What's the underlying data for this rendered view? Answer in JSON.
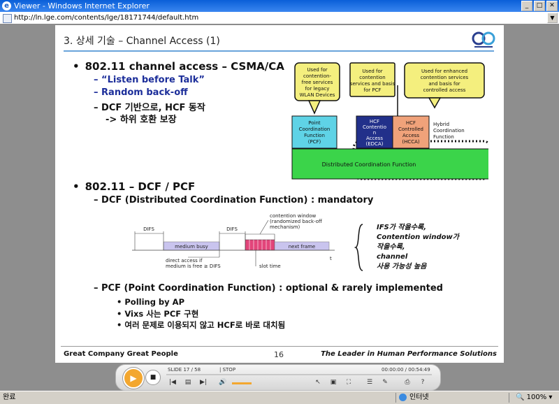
{
  "window": {
    "title": "Viewer - Windows Internet Explorer",
    "address": "http://ln.lge.com/contents/lge/18171744/default.htm"
  },
  "slide": {
    "title": "3. 상세 기술 – Channel Access (1)",
    "bullet1": "802.11 channel access – CSMA/CA",
    "sub1_1": "“Listen before Talk”",
    "sub1_2": "Random back-off",
    "sub1_3": "DCF 기반으로, HCF 동작",
    "sub1_4": "-> 하위 호환 보장",
    "diagram1": {
      "callout1": [
        "Used for",
        "contention-",
        "free services",
        "for legacy",
        "WLAN Devices"
      ],
      "callout2": [
        "Used for",
        "contention",
        "services and basis",
        "for PCF"
      ],
      "callout3": [
        "Used for enhanced",
        "contention services",
        "and basis for",
        "controlled access"
      ],
      "pcf": [
        "Point",
        "Coordination",
        "Function",
        "(PCF)"
      ],
      "hcf_contention": [
        "HCF",
        "Contentio",
        "n",
        "Access",
        "(EDCA)"
      ],
      "hcf_controlled": [
        "HCF",
        "Controlled",
        "Access",
        "(HCCA)"
      ],
      "hybrid": [
        "Hybrid",
        "Coordination",
        "Function"
      ],
      "dcf": "Distributed Coordination Function"
    },
    "bullet2": "802.11 – DCF / PCF",
    "sub2_1": "DCF (Distributed Coordination Function) : mandatory",
    "diagram2": {
      "difs1": "DIFS",
      "difs2": "DIFS",
      "contention": [
        "contention window",
        "(randomized back-off",
        "mechanism)"
      ],
      "medium_busy": "medium busy",
      "next_frame": "next frame",
      "direct": [
        "direct access if",
        "medium is free ≥ DIFS"
      ],
      "slot": "slot time",
      "t": "t"
    },
    "note": [
      "IFS가 작을수록,",
      "Contention window가",
      "작을수록,",
      "channel",
      "사용 가능성 높음"
    ],
    "sub2_2": "PCF (Point Coordination Function) : optional & rarely implemented",
    "sub2_2a": "Polling by AP",
    "sub2_2b": "Vixs 사는 PCF 구현",
    "sub2_2c": "여러 문제로 이용되지 않고 HCF로 바로 대치됨",
    "footer_left": "Great Company   Great People",
    "footer_num": "16",
    "footer_right": "The Leader in Human Performance Solutions"
  },
  "player": {
    "slide_info": "SLIDE  17 / 58",
    "state": "|  STOP",
    "time": "00:00:00 / 00:54:49",
    "volume_level": 0.7
  },
  "status": {
    "left": "완료",
    "zone": "인터넷",
    "zoom": "100%"
  },
  "colors": {
    "pcf": "#5fd3e6",
    "hcf_contention": "#22308a",
    "hcf_controlled": "#f0a27a",
    "dcf": "#3bd44a",
    "callout": "#f4ef7e",
    "contention_window": "#e2457a",
    "medium_busy": "#c9c4ee"
  }
}
